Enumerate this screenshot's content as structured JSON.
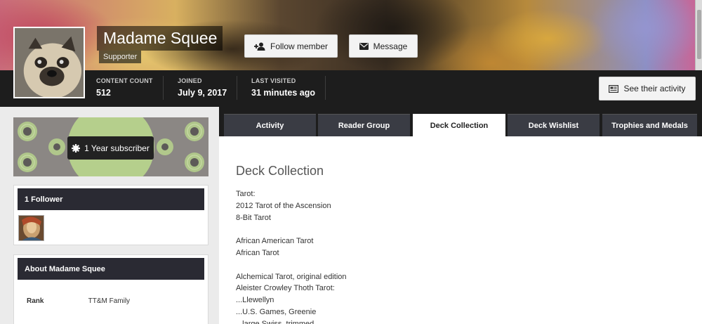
{
  "profile": {
    "name": "Madame Squee",
    "group": "Supporter",
    "follow_label": "Follow member",
    "message_label": "Message",
    "activity_label": "See their activity"
  },
  "stats": [
    {
      "label": "CONTENT COUNT",
      "value": "512"
    },
    {
      "label": "JOINED",
      "value": "July 9, 2017"
    },
    {
      "label": "LAST VISITED",
      "value": "31 minutes ago"
    }
  ],
  "sidebar": {
    "badge_label": "1 Year subscriber",
    "followers_title": "1 Follower",
    "about_title": "About Madame Squee",
    "about_rows": [
      {
        "key": "Rank",
        "value": "TT&M Family"
      }
    ]
  },
  "tabs": [
    {
      "label": "Activity",
      "active": false
    },
    {
      "label": "Reader Group",
      "active": false
    },
    {
      "label": "Deck Collection",
      "active": true
    },
    {
      "label": "Deck Wishlist",
      "active": false
    },
    {
      "label": "Trophies and Medals",
      "active": false
    }
  ],
  "content": {
    "title": "Deck Collection",
    "lines": [
      "Tarot:",
      "2012 Tarot of the Ascension",
      "8-Bit Tarot",
      "",
      "African American Tarot",
      "African Tarot",
      "",
      "Alchemical Tarot, original edition",
      "Aleister Crowley Thoth Tarot:",
      "...Llewellyn",
      "...U.S. Games, Greenie",
      "...large Swiss, trimmed"
    ]
  },
  "icons": {
    "follow": "user-plus-icon",
    "message": "envelope-icon",
    "activity": "activity-icon",
    "badge": "badge-icon"
  }
}
